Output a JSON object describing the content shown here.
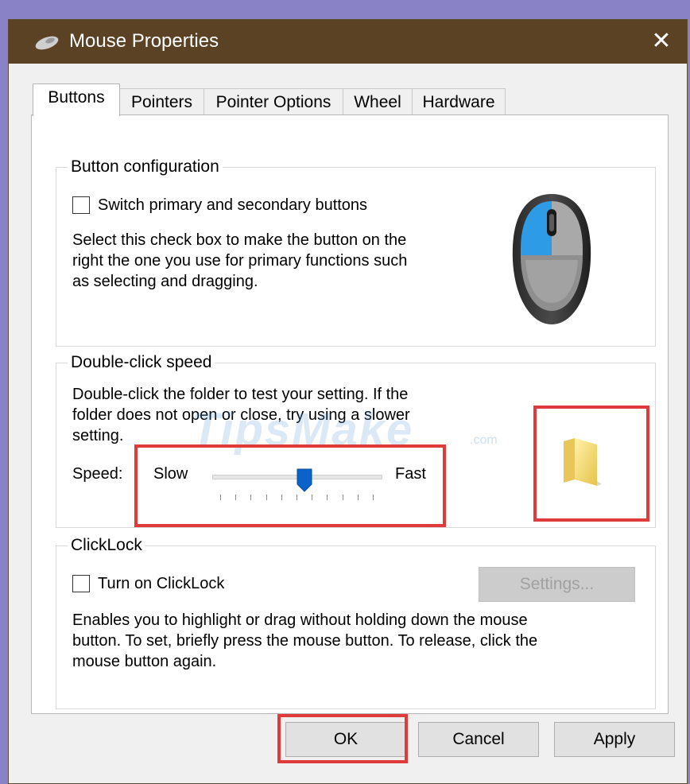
{
  "window": {
    "title": "Mouse Properties",
    "close_symbol": "✕",
    "titlebar_color": "#5b4225",
    "icon": "mouse-icon"
  },
  "tabs": [
    {
      "label": "Buttons",
      "active": true
    },
    {
      "label": "Pointers",
      "active": false
    },
    {
      "label": "Pointer Options",
      "active": false
    },
    {
      "label": "Wheel",
      "active": false
    },
    {
      "label": "Hardware",
      "active": false
    }
  ],
  "button_configuration": {
    "group_title": "Button configuration",
    "checkbox_label": "Switch primary and secondary buttons",
    "checked": false,
    "description_lines": [
      "Select this check box to make the button on the",
      "right the one you use for primary functions such",
      "as selecting and dragging."
    ]
  },
  "double_click": {
    "group_title": "Double-click speed",
    "description_lines": [
      "Double-click the folder to test your setting. If the",
      "folder does not open or close, try using a slower",
      "setting."
    ],
    "speed_label": "Speed:",
    "slow_label": "Slow",
    "fast_label": "Fast",
    "speed_value": 0.55,
    "tick_count": 11,
    "highlight_color": "#e03a3a"
  },
  "clicklock": {
    "group_title": "ClickLock",
    "checkbox_label": "Turn on ClickLock",
    "checked": false,
    "settings_button": "Settings...",
    "description_lines": [
      "Enables you to highlight or drag without holding down the mouse",
      "button. To set, briefly press the mouse button. To release, click the",
      "mouse button again."
    ]
  },
  "footer": {
    "ok": "OK",
    "cancel": "Cancel",
    "apply": "Apply"
  },
  "watermark": {
    "text": "TipsMake",
    "suffix": ".com"
  }
}
